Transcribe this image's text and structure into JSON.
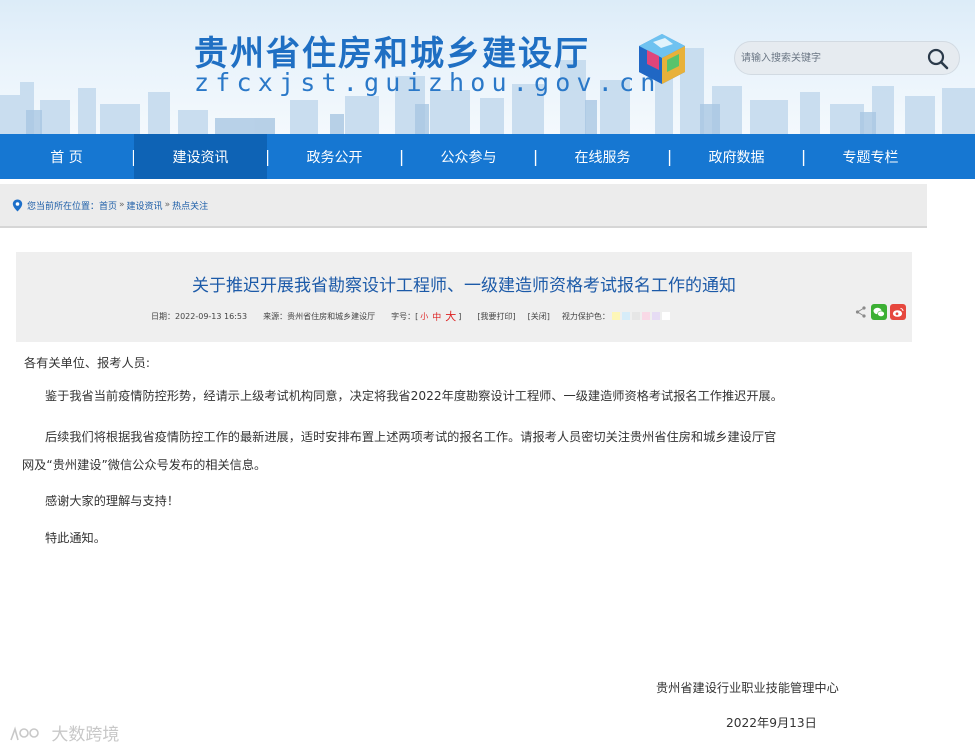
{
  "header": {
    "site_title": "贵州省住房和城乡建设厅",
    "site_url": "zfcxjst.guizhou.gov.cn",
    "search_placeholder": "请输入搜索关键字"
  },
  "nav": {
    "items": [
      {
        "label": "首 页"
      },
      {
        "label": "建设资讯"
      },
      {
        "label": "政务公开"
      },
      {
        "label": "公众参与"
      },
      {
        "label": "在线服务"
      },
      {
        "label": "政府数据"
      },
      {
        "label": "专题专栏"
      }
    ],
    "separator": "|",
    "active_index": 1
  },
  "breadcrumb": {
    "prefix": "您当前所在位置：",
    "links": [
      "首页",
      "建设资讯",
      "热点关注"
    ],
    "separator": "»"
  },
  "article": {
    "title": "关于推迟开展我省勘察设计工程师、一级建造师资格考试报名工作的通知",
    "date": "日期：2022-09-13 16:53",
    "source": "来源：贵州省住房和城乡建设厅",
    "font_size_label": "字号：[",
    "font_small": "小",
    "font_medium": "中",
    "font_large": "大",
    "font_close": "]",
    "print_label": "[我要打印]",
    "close_label": "[关闭]",
    "eye_label": "视力保护色：",
    "eye_colors": [
      "#fdf6b7",
      "#d6ecf9",
      "#e6e6e6",
      "#f9d9e6",
      "#e6dcf4",
      "#ffffff"
    ],
    "paragraphs": [
      "各有关单位、报考人员:",
      "鉴于我省当前疫情防控形势，经请示上级考试机构同意，决定将我省2022年度勘察设计工程师、一级建造师资格考试报名工作推迟开展。",
      "后续我们将根据我省疫情防控工作的最新进展，适时安排布置上述两项考试的报名工作。请报考人员密切关注贵州省住房和城乡建设厅官",
      "网及“贵州建设”微信公众号发布的相关信息。",
      "感谢大家的理解与支持！",
      "特此通知。"
    ],
    "signature_org": "贵州省建设行业职业技能管理中心",
    "signature_date": "2022年9月13日"
  },
  "share": {
    "icons": [
      "share-icon",
      "wechat-icon",
      "weibo-icon"
    ],
    "wechat_color": "#3cb034",
    "weibo_color": "#e6473d"
  },
  "watermark": "大数跨境",
  "colors": {
    "nav_bg": "#1677d2",
    "nav_active": "#0e63b5",
    "title_blue": "#1c5aa8"
  }
}
